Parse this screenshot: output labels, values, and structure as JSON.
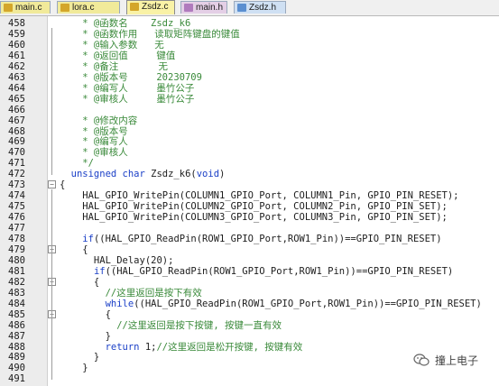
{
  "tabs": [
    {
      "label": "main.c",
      "style": "yellow"
    },
    {
      "label": "lora.c",
      "style": "yellow"
    },
    {
      "label": "Zsdz.c",
      "style": "active"
    },
    {
      "label": "main.h",
      "style": "purple"
    },
    {
      "label": "Zsdz.h",
      "style": "blue"
    }
  ],
  "lines": [
    {
      "n": "458",
      "parts": [
        {
          "t": "    * @函数名    Zsdz_k6",
          "c": "cm"
        }
      ]
    },
    {
      "n": "459",
      "parts": [
        {
          "t": "    * @函数作用   读取矩阵键盘的键值",
          "c": "cm"
        }
      ]
    },
    {
      "n": "460",
      "parts": [
        {
          "t": "    * @输入参数   无",
          "c": "cm"
        }
      ]
    },
    {
      "n": "461",
      "parts": [
        {
          "t": "    * @返回值     键值",
          "c": "cm"
        }
      ]
    },
    {
      "n": "462",
      "parts": [
        {
          "t": "    * @备注       无",
          "c": "cm"
        }
      ]
    },
    {
      "n": "463",
      "parts": [
        {
          "t": "    * @版本号     20230709",
          "c": "cm"
        }
      ]
    },
    {
      "n": "464",
      "parts": [
        {
          "t": "    * @编写人     墨竹公子",
          "c": "cm"
        }
      ]
    },
    {
      "n": "465",
      "parts": [
        {
          "t": "    * @审核人     墨竹公子",
          "c": "cm"
        }
      ]
    },
    {
      "n": "466",
      "parts": [
        {
          "t": "",
          "c": ""
        }
      ]
    },
    {
      "n": "467",
      "parts": [
        {
          "t": "    * @修改内容",
          "c": "cm"
        }
      ]
    },
    {
      "n": "468",
      "parts": [
        {
          "t": "    * @版本号",
          "c": "cm"
        }
      ]
    },
    {
      "n": "469",
      "parts": [
        {
          "t": "    * @编写人",
          "c": "cm"
        }
      ]
    },
    {
      "n": "470",
      "parts": [
        {
          "t": "    * @审核人",
          "c": "cm"
        }
      ]
    },
    {
      "n": "471",
      "parts": [
        {
          "t": "    */",
          "c": "cm"
        }
      ]
    },
    {
      "n": "472",
      "parts": [
        {
          "t": "  unsigned char",
          "c": "kw"
        },
        {
          "t": " Zsdz_k6(",
          "c": ""
        },
        {
          "t": "void",
          "c": "kw"
        },
        {
          "t": ")",
          "c": ""
        }
      ]
    },
    {
      "n": "473",
      "fold": "box",
      "parts": [
        {
          "t": "{",
          "c": ""
        }
      ]
    },
    {
      "n": "474",
      "parts": [
        {
          "t": "    HAL_GPIO_WritePin(COLUMN1_GPIO_Port, COLUMN1_Pin, GPIO_PIN_RESET);",
          "c": ""
        }
      ]
    },
    {
      "n": "475",
      "parts": [
        {
          "t": "    HAL_GPIO_WritePin(COLUMN2_GPIO_Port, COLUMN2_Pin, GPIO_PIN_SET);",
          "c": ""
        }
      ]
    },
    {
      "n": "476",
      "parts": [
        {
          "t": "    HAL_GPIO_WritePin(COLUMN3_GPIO_Port, COLUMN3_Pin, GPIO_PIN_SET);",
          "c": ""
        }
      ]
    },
    {
      "n": "477",
      "parts": [
        {
          "t": "",
          "c": ""
        }
      ]
    },
    {
      "n": "478",
      "parts": [
        {
          "t": "    ",
          "c": ""
        },
        {
          "t": "if",
          "c": "kw"
        },
        {
          "t": "((HAL_GPIO_ReadPin(ROW1_GPIO_Port,ROW1_Pin))==GPIO_PIN_RESET)",
          "c": ""
        }
      ]
    },
    {
      "n": "479",
      "fold": "box",
      "parts": [
        {
          "t": "    {",
          "c": ""
        }
      ]
    },
    {
      "n": "480",
      "parts": [
        {
          "t": "      HAL_Delay(20);",
          "c": ""
        }
      ]
    },
    {
      "n": "481",
      "parts": [
        {
          "t": "      ",
          "c": ""
        },
        {
          "t": "if",
          "c": "kw"
        },
        {
          "t": "((HAL_GPIO_ReadPin(ROW1_GPIO_Port,ROW1_Pin))==GPIO_PIN_RESET)",
          "c": ""
        }
      ]
    },
    {
      "n": "482",
      "fold": "box",
      "parts": [
        {
          "t": "      {",
          "c": ""
        }
      ]
    },
    {
      "n": "483",
      "parts": [
        {
          "t": "        //这里返回是按下有效",
          "c": "cm"
        }
      ]
    },
    {
      "n": "484",
      "parts": [
        {
          "t": "        ",
          "c": ""
        },
        {
          "t": "while",
          "c": "kw"
        },
        {
          "t": "((HAL_GPIO_ReadPin(ROW1_GPIO_Port,ROW1_Pin))==GPIO_PIN_RESET)",
          "c": ""
        }
      ]
    },
    {
      "n": "485",
      "fold": "box",
      "parts": [
        {
          "t": "        {",
          "c": ""
        }
      ]
    },
    {
      "n": "486",
      "parts": [
        {
          "t": "          //这里返回是按下按键, 按键一直有效",
          "c": "cm"
        }
      ]
    },
    {
      "n": "487",
      "parts": [
        {
          "t": "        }",
          "c": ""
        }
      ]
    },
    {
      "n": "488",
      "parts": [
        {
          "t": "        ",
          "c": ""
        },
        {
          "t": "return",
          "c": "kw"
        },
        {
          "t": " 1;",
          "c": ""
        },
        {
          "t": "//这里返回是松开按键, 按键有效",
          "c": "cm"
        }
      ]
    },
    {
      "n": "489",
      "parts": [
        {
          "t": "      }",
          "c": ""
        }
      ]
    },
    {
      "n": "490",
      "parts": [
        {
          "t": "    }",
          "c": ""
        }
      ]
    },
    {
      "n": "491",
      "parts": [
        {
          "t": "",
          "c": ""
        }
      ]
    }
  ],
  "watermark": {
    "text": "撞上电子"
  }
}
